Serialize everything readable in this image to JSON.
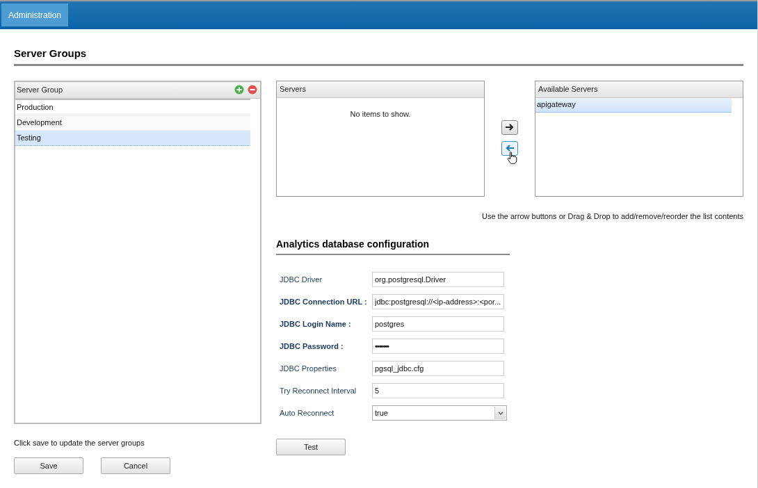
{
  "nav": {
    "tabs": [
      {
        "label": "Administration",
        "selected": true
      }
    ]
  },
  "title": "Server Groups",
  "server_group_list": {
    "header": "Server Group",
    "items": [
      {
        "label": "Production",
        "selected": false
      },
      {
        "label": "Development",
        "selected": false
      },
      {
        "label": "Testing",
        "selected": true
      }
    ]
  },
  "servers_list": {
    "header": "Servers",
    "empty_text": "No items to show."
  },
  "arrow_buttons": [
    {
      "kind": "right",
      "hovered": false
    },
    {
      "kind": "left",
      "hovered": true
    }
  ],
  "available_list": {
    "header": "Available Servers",
    "items": [
      {
        "label": "apigateway",
        "selected": true
      }
    ]
  },
  "hint": "Use the arrow buttons or Drag & Drop to add/remove/reorder the list contents",
  "db_config": {
    "title": "Analytics database configuration",
    "fields": [
      {
        "label": "JDBC Driver",
        "bold": false,
        "kind": "text",
        "value": "org.postgresql.Driver"
      },
      {
        "label": "JDBC Connection URL :",
        "bold": true,
        "kind": "text",
        "value": "jdbc:postgresql://<ip-address>:<por..."
      },
      {
        "label": "JDBC Login Name :",
        "bold": true,
        "kind": "text",
        "value": "postgres"
      },
      {
        "label": "JDBC Password :",
        "bold": true,
        "kind": "password",
        "value": "•••••••"
      },
      {
        "label": "JDBC Properties",
        "bold": false,
        "kind": "text",
        "value": "pgsql_jdbc.cfg"
      },
      {
        "label": "Try Reconnect Interval",
        "bold": false,
        "kind": "text",
        "value": "5"
      },
      {
        "label": "Auto Reconnect",
        "bold": false,
        "kind": "select",
        "value": "true"
      }
    ],
    "test_button": "Test"
  },
  "save_note": "Click save to update the server groups",
  "buttons": [
    "Save",
    "Cancel"
  ]
}
